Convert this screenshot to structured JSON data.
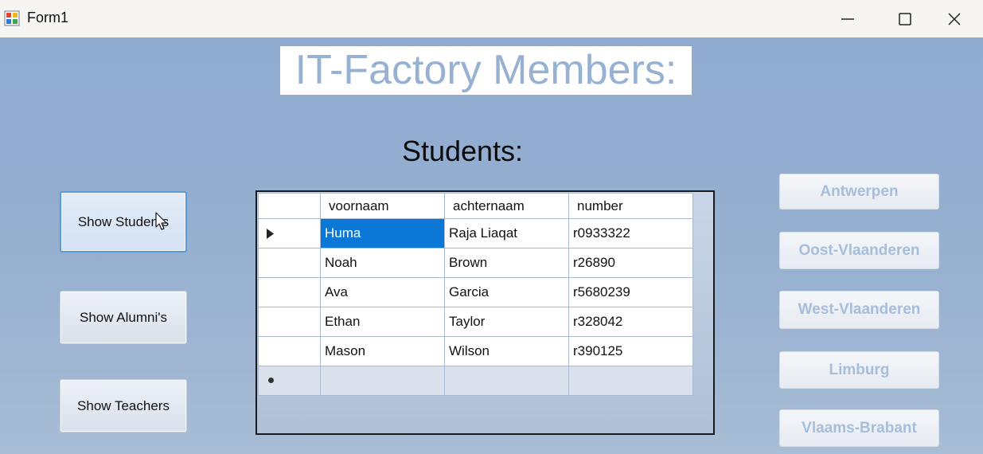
{
  "window": {
    "title": "Form1"
  },
  "form": {
    "main_title": "IT-Factory Members:",
    "section_title": "Students:"
  },
  "left_buttons": [
    {
      "label": "Show Students"
    },
    {
      "label": "Show Alumni's"
    },
    {
      "label": "Show Teachers"
    }
  ],
  "grid": {
    "columns": [
      "voornaam",
      "achternaam",
      "number"
    ],
    "rows": [
      [
        "Huma",
        "Raja Liaqat",
        "r0933322"
      ],
      [
        "Noah",
        "Brown",
        "r26890"
      ],
      [
        "Ava",
        "Garcia",
        "r5680239"
      ],
      [
        "Ethan",
        "Taylor",
        "r328042"
      ],
      [
        "Mason",
        "Wilson",
        "r390125"
      ]
    ]
  },
  "right_buttons": [
    {
      "label": "Antwerpen"
    },
    {
      "label": "Oost-Vlaanderen"
    },
    {
      "label": "West-Vlaanderen"
    },
    {
      "label": "Limburg"
    },
    {
      "label": "Vlaams-Brabant"
    }
  ],
  "colors": {
    "background": "#95afd0",
    "title_text": "#97b1d2",
    "selection": "#0b78d7",
    "right_button_text": "#a7bedb"
  }
}
